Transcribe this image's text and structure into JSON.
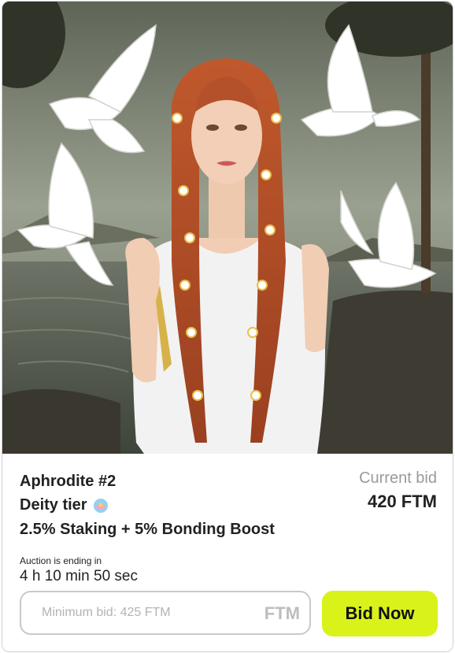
{
  "nft": {
    "name": "Aphrodite #2",
    "tier": "Deity tier",
    "tier_icon": "shell-icon",
    "perks": "2.5% Staking + 5% Bonding Boost",
    "image_alt": "Aphrodite"
  },
  "bid": {
    "current_label": "Current bid",
    "current_value": "420 FTM",
    "currency": "FTM",
    "input_placeholder": "Minimum bid: 425 FTM",
    "button_label": "Bid Now"
  },
  "auction": {
    "ending_label": "Auction is ending in",
    "ending_value": "4 h 10 min 50 sec"
  },
  "colors": {
    "accent": "#d9f21a",
    "hair": "#b5512a",
    "sky": "#7a8070",
    "text": "#222222",
    "muted": "#9a9a9a"
  }
}
